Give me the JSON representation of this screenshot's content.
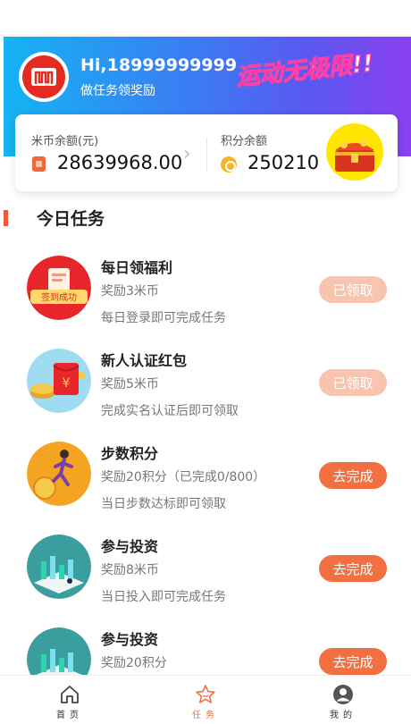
{
  "header": {
    "greeting": "Hi,18999999999",
    "subtitle": "做任务领奖励",
    "banner_slogan": "运动无极限!!"
  },
  "balance": {
    "mi_label": "米币余额(元)",
    "mi_value": "28639968.00",
    "points_label": "积分余额",
    "points_value": "250210"
  },
  "section": {
    "title": "今日任务"
  },
  "tasks": [
    {
      "title": "每日领福利",
      "reward": "奖励3米币",
      "desc": "每日登录即可完成任务",
      "action": "已领取",
      "status": "claimed",
      "icon": "sign-in-badge-icon",
      "badge_text": "签到成功"
    },
    {
      "title": "新人认证红包",
      "reward": "奖励5米币",
      "desc": "完成实名认证后即可领取",
      "action": "已领取",
      "status": "claimed",
      "icon": "red-envelope-icon",
      "badge_text": "¥"
    },
    {
      "title": "步数积分",
      "reward": "奖励20积分（已完成0/800）",
      "desc": "当日步数达标即可领取",
      "action": "去完成",
      "status": "pending",
      "icon": "runner-icon"
    },
    {
      "title": "参与投资",
      "reward": "奖励8米币",
      "desc": "当日投入即可完成任务",
      "action": "去完成",
      "status": "pending",
      "icon": "investment-chart-icon"
    },
    {
      "title": "参与投资",
      "reward": "奖励20积分",
      "desc": "",
      "action": "去完成",
      "status": "pending",
      "icon": "investment-chart-icon"
    }
  ],
  "tabs": [
    {
      "label": "首页",
      "icon": "home-icon",
      "active": false
    },
    {
      "label": "任务",
      "icon": "star-icon",
      "active": true
    },
    {
      "label": "我的",
      "icon": "user-icon",
      "active": false
    }
  ],
  "colors": {
    "accent": "#f16f41",
    "claimed": "#f8c4ad",
    "hero_start": "#14b4f2",
    "hero_end": "#8a3ff0"
  }
}
